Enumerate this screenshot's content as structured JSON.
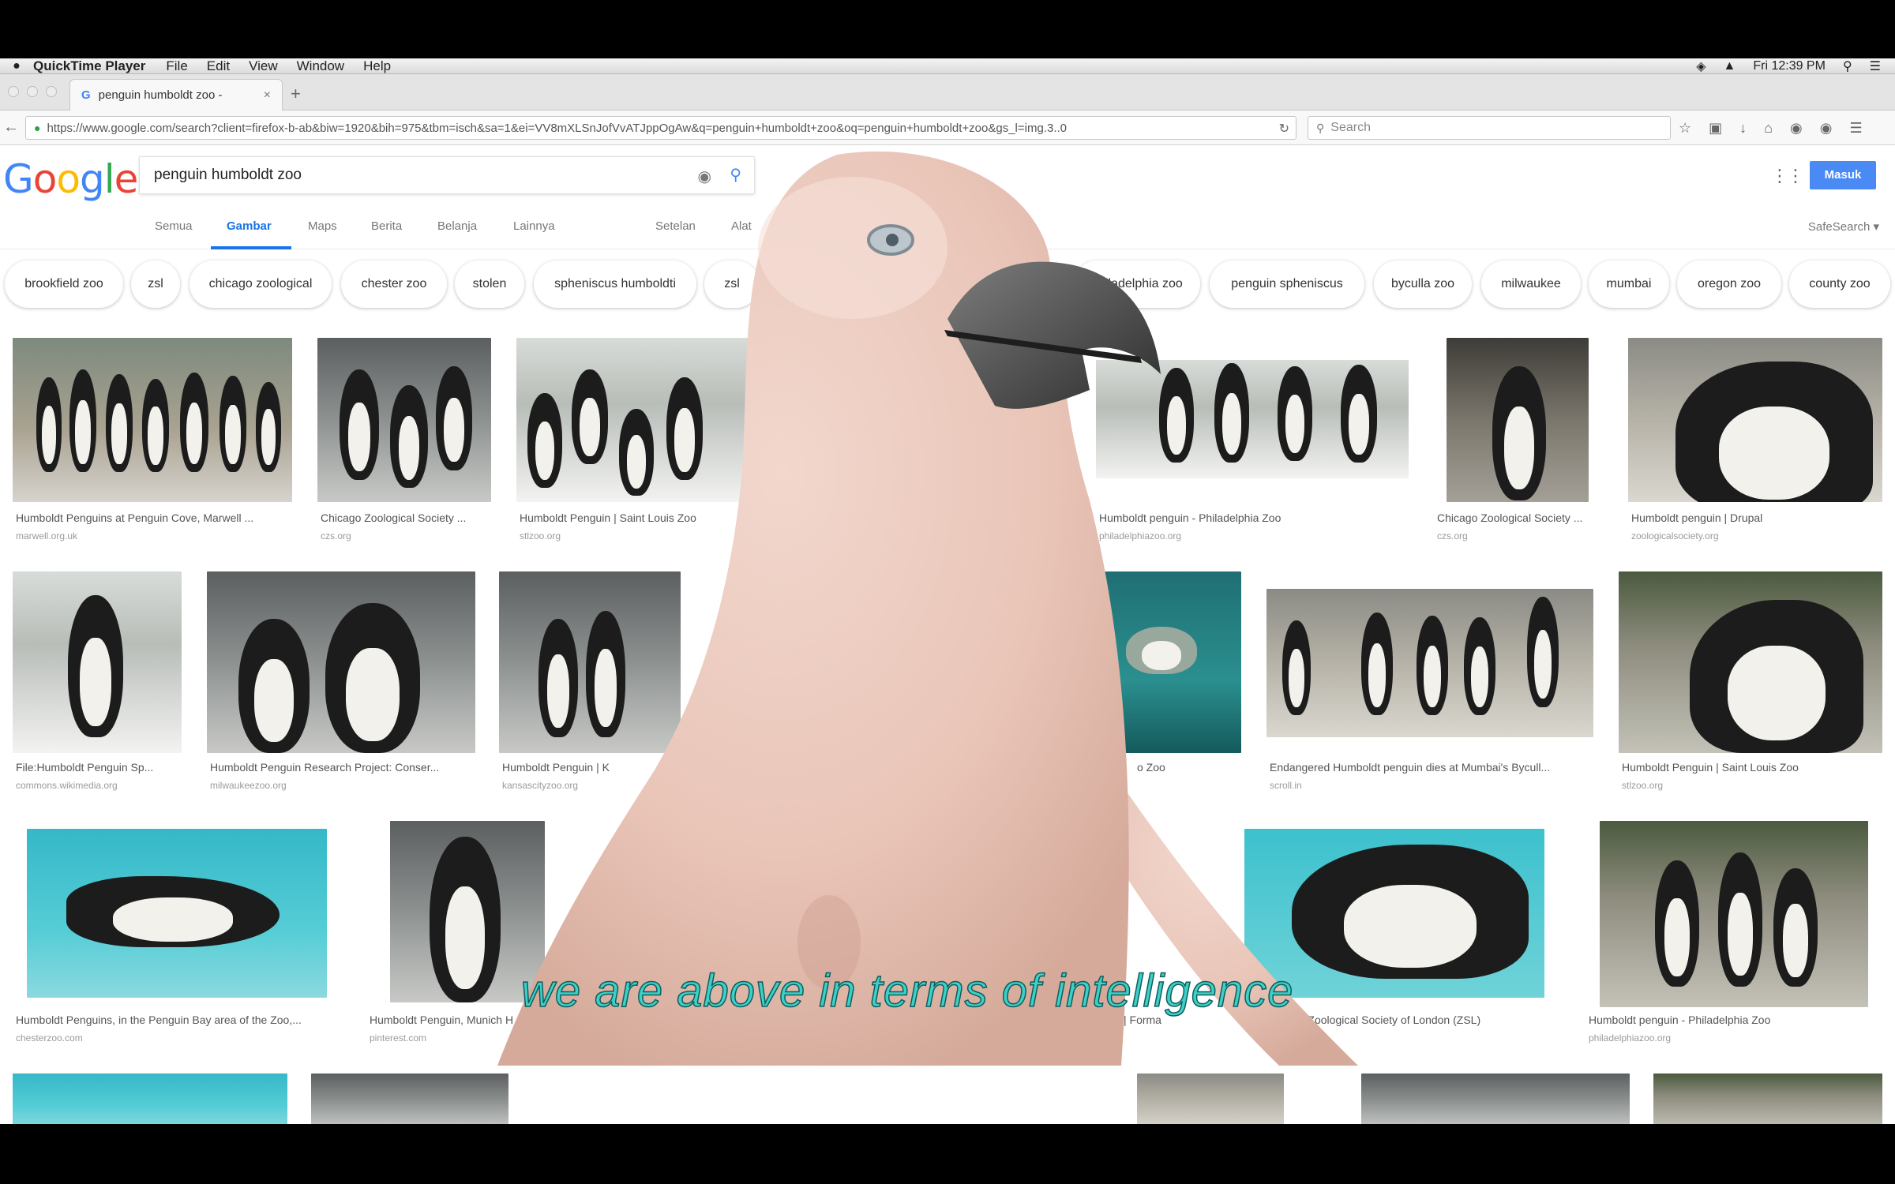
{
  "menubar": {
    "app_name": "QuickTime Player",
    "items": [
      "File",
      "Edit",
      "View",
      "Window",
      "Help"
    ],
    "clock": "Fri 12:39 PM"
  },
  "browser": {
    "tab_title": "penguin humboldt zoo -",
    "url": "https://www.google.com/search?client=firefox-b-ab&biw=1920&bih=975&tbm=isch&sa=1&ei=VV8mXLSnJofVvATJppOgAw&q=penguin+humboldt+zoo&oq=penguin+humboldt+zoo&gs_l=img.3..0",
    "search_placeholder": "Search"
  },
  "google": {
    "query": "penguin humboldt zoo",
    "signin_label": "Masuk",
    "safesearch": "SafeSearch ▾",
    "tabs": [
      "Semua",
      "Gambar",
      "Maps",
      "Berita",
      "Belanja",
      "Lainnya",
      "Setelan",
      "Alat"
    ],
    "chips": [
      "brookfield zoo",
      "zsl",
      "chicago zoological",
      "chester zoo",
      "stolen",
      "spheniscus humboldti",
      "zsl",
      "philadelphia zoo",
      "penguin spheniscus",
      "byculla zoo",
      "milwaukee",
      "mumbai",
      "oregon zoo",
      "county zoo"
    ]
  },
  "results": {
    "row1": [
      {
        "caption": "Humboldt Penguins at Penguin Cove, Marwell ...",
        "source": "marwell.org.uk"
      },
      {
        "caption": "Chicago Zoological Society ...",
        "source": "czs.org"
      },
      {
        "caption": "Humboldt Penguin | Saint Louis Zoo",
        "source": "stlzoo.org"
      },
      {
        "caption": "Humboldt penguin - Philadelphia Zoo",
        "source": "philadelphiazoo.org"
      },
      {
        "caption": "Chicago Zoological Society ...",
        "source": "czs.org"
      },
      {
        "caption": "Humboldt penguin | Drupal",
        "source": "zoologicalsociety.org"
      }
    ],
    "row2": [
      {
        "caption": "File:Humboldt Penguin Sp...",
        "source": "commons.wikimedia.org"
      },
      {
        "caption": "Humboldt Penguin Research Project: Conser...",
        "source": "milwaukeezoo.org"
      },
      {
        "caption": "Humboldt Penguin | K",
        "source": "kansascityzoo.org"
      },
      {
        "caption": "o Zoo",
        "source": ""
      },
      {
        "caption": "Endangered Humboldt penguin dies at Mumbai's Bycull...",
        "source": "scroll.in"
      },
      {
        "caption": "Humboldt Penguin | Saint Louis Zoo",
        "source": "stlzoo.org"
      }
    ],
    "row3": [
      {
        "caption": "Humboldt Penguins, in the Penguin Bay area of the Zoo,...",
        "source": "chesterzoo.com"
      },
      {
        "caption": "Humboldt Penguin, Munich H",
        "source": "pinterest.com"
      },
      {
        "caption": "WPZ | Forma",
        "source": ""
      },
      {
        "caption": "boldt) | Zoological Society of London (ZSL)",
        "source": ""
      },
      {
        "caption": "Humboldt penguin - Philadelphia Zoo",
        "source": "philadelphiazoo.org"
      }
    ]
  },
  "subtitle": "we are above in terms of intelligence",
  "colors": {
    "accent": "#1a73e8",
    "subtitle": "#3dd0c8",
    "signin": "#4a8af4"
  }
}
